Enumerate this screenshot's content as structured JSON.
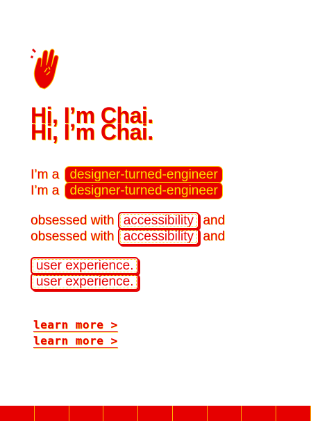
{
  "hero": {
    "greeting": "Hi, I’m Chai.",
    "greeting_echo": "Hi, I’m Chai.",
    "intro_prefix": "I’m a",
    "role_highlight": "designer-turned-engineer",
    "obsessed_prefix": "obsessed with",
    "focus_1": "accessibility",
    "conjunction": "and",
    "focus_2": "user experience."
  },
  "cta": {
    "learn_more": "learn more >"
  },
  "icons": {
    "hand": "waving-hand-icon"
  },
  "colors": {
    "accent": "#e60000",
    "highlight": "#ffe000",
    "background": "#ffffff"
  }
}
